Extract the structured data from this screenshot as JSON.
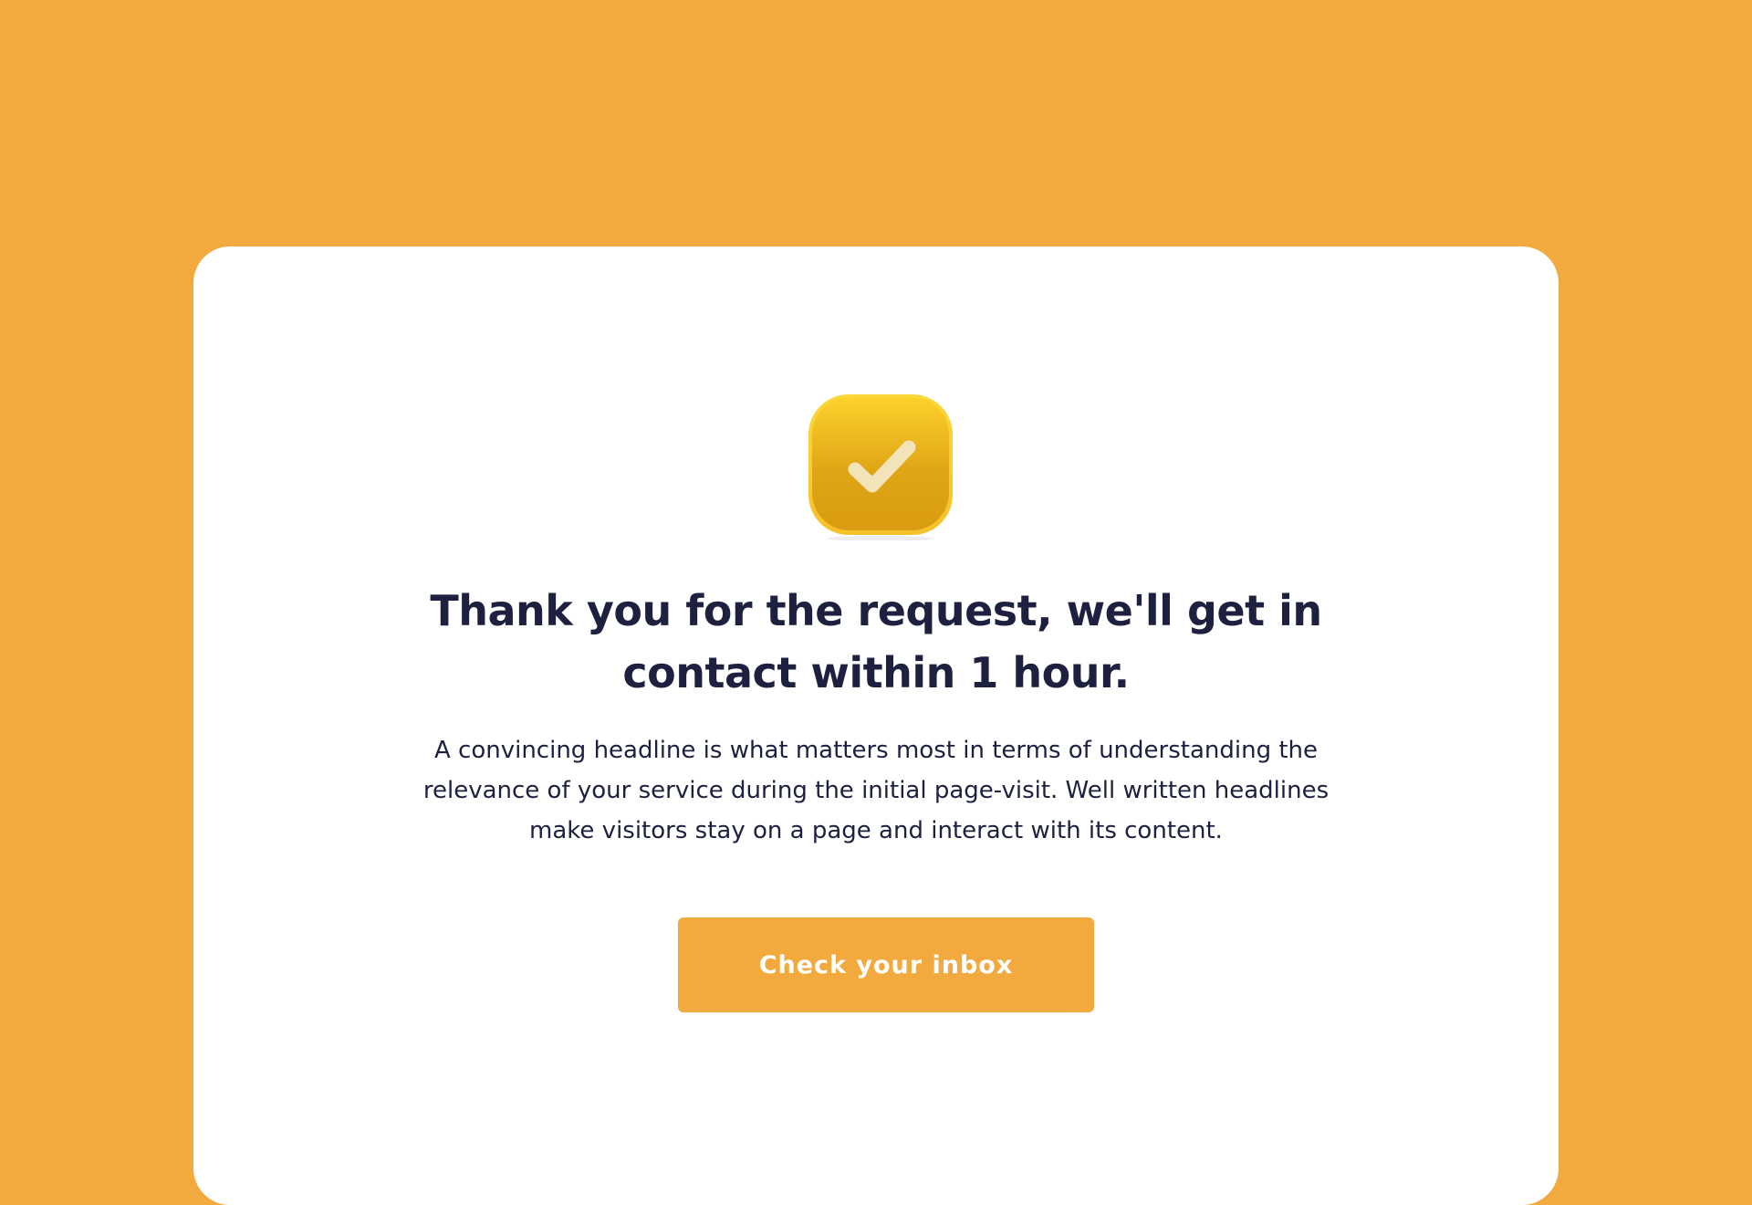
{
  "confirmation": {
    "icon": "checkmark-badge-icon",
    "headline": "Thank you for the request, we'll get in contact within 1 hour.",
    "description": "A convincing headline is what matters most in terms of understanding the relevance of your service during the initial page-visit. Well written headlines make visitors stay on a page and interact with its content.",
    "button_label": "Check your inbox"
  },
  "colors": {
    "background": "#f2a93e",
    "card": "#ffffff",
    "text": "#1e2040",
    "button": "#f2a93e",
    "icon_top": "#fcd02a",
    "icon_bottom": "#dda114"
  }
}
